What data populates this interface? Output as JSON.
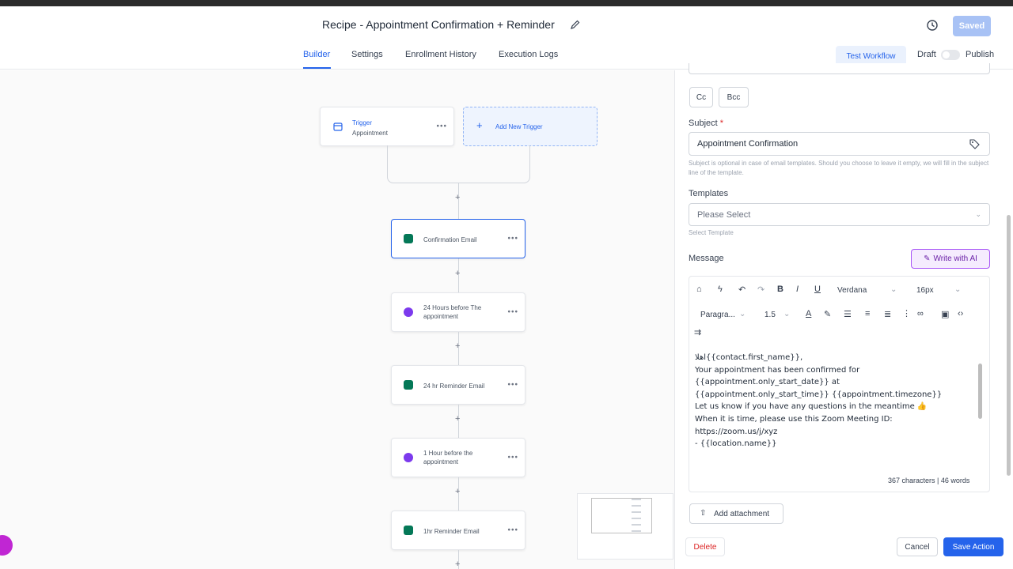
{
  "header": {
    "title": "Recipe - Appointment Confirmation + Reminder",
    "saved_label": "Saved"
  },
  "tabs": [
    {
      "label": "Builder",
      "active": true
    },
    {
      "label": "Settings"
    },
    {
      "label": "Enrollment History"
    },
    {
      "label": "Execution Logs"
    }
  ],
  "actions": {
    "test_workflow": "Test Workflow",
    "draft": "Draft",
    "publish": "Publish"
  },
  "workflow": {
    "trigger_title": "Trigger",
    "trigger_subtitle": "Appointment",
    "add_trigger": "Add New Trigger",
    "nodes": [
      {
        "label": "Confirmation Email",
        "type": "email"
      },
      {
        "label": "24 Hours before The appointment",
        "type": "wait"
      },
      {
        "label": "24 hr Reminder Email",
        "type": "email"
      },
      {
        "label": "1 Hour before the appointment",
        "type": "wait"
      },
      {
        "label": "1hr Reminder Email",
        "type": "email"
      }
    ]
  },
  "panel": {
    "cc": "Cc",
    "bcc": "Bcc",
    "subject_label": "Subject",
    "subject_required": "*",
    "subject_value": "Appointment Confirmation",
    "subject_help": "Subject is optional in case of email templates. Should you choose to leave it empty, we will fill in the subject line of the template.",
    "templates_label": "Templates",
    "templates_placeholder": "Please Select",
    "templates_help": "Select Template",
    "message_label": "Message",
    "write_ai": "Write with AI",
    "font_family": "Verdana",
    "font_size": "16px",
    "paragraph": "Paragra...",
    "line_height": "1.5",
    "message_lines": [
      "اهلا{{contact.first_name}},",
      "Your appointment has been confirmed for",
      "{{appointment.only_start_date}} at",
      "{{appointment.only_start_time}} {{appointment.timezone}}",
      "",
      "Let us know if you have any questions in the meantime 👍",
      "When it is time, please use this Zoom Meeting ID:",
      "https://zoom.us/j/xyz",
      "- {{location.name}}"
    ],
    "counts": "367 characters | 46 words",
    "add_attachment": "Add attachment",
    "delete": "Delete",
    "cancel": "Cancel",
    "save_action": "Save Action"
  },
  "colors": {
    "accent": "#2563eb",
    "email_icon": "#047857",
    "wait_icon": "#7c3aed",
    "ai_border": "#a855f7"
  }
}
